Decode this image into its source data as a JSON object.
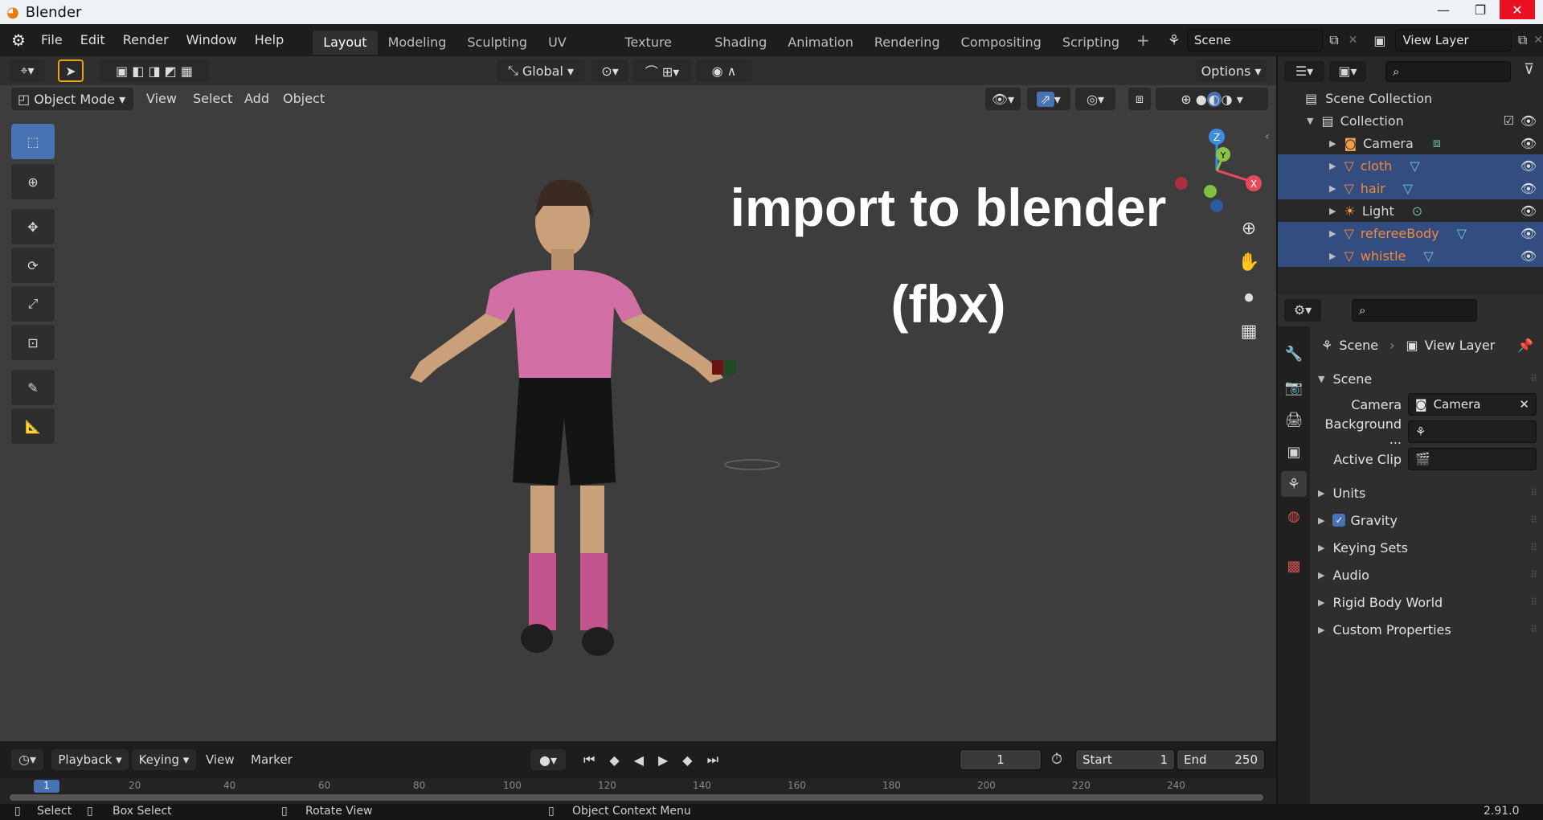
{
  "window": {
    "title": "Blender",
    "minimize": "—",
    "restore": "❐",
    "close": "✕"
  },
  "menu": [
    "File",
    "Edit",
    "Render",
    "Window",
    "Help"
  ],
  "workspaces": [
    "Layout",
    "Modeling",
    "Sculpting",
    "UV Editing",
    "Texture Paint",
    "Shading",
    "Animation",
    "Rendering",
    "Compositing",
    "Scripting"
  ],
  "active_workspace": "Layout",
  "scene_field": "Scene",
  "view_layer_field": "View Layer",
  "toolbar": {
    "transform_orientation": "Global",
    "options": "Options"
  },
  "viewport_header": {
    "mode": "Object Mode",
    "menus": [
      "View",
      "Select",
      "Add",
      "Object"
    ]
  },
  "overlay": {
    "line1": "import to blender",
    "line2": "(fbx)"
  },
  "gizmo": {
    "x": "X",
    "y": "Y",
    "z": "Z"
  },
  "outliner": {
    "root": "Scene Collection",
    "collection": "Collection",
    "items": [
      {
        "name": "Camera",
        "selected": false,
        "color": "#e0e0e0"
      },
      {
        "name": "cloth",
        "selected": true,
        "color": "#f08a3a"
      },
      {
        "name": "hair",
        "selected": true,
        "color": "#f08a3a"
      },
      {
        "name": "Light",
        "selected": false,
        "color": "#e0e0e0"
      },
      {
        "name": "refereeBody",
        "selected": true,
        "color": "#f08a3a"
      },
      {
        "name": "whistle",
        "selected": true,
        "color": "#f08a3a"
      }
    ]
  },
  "properties": {
    "breadcrumb_scene": "Scene",
    "breadcrumb_view_layer": "View Layer",
    "panel_title": "Scene",
    "camera_label": "Camera",
    "camera_value": "Camera",
    "background_label": "Background ...",
    "active_clip_label": "Active Clip",
    "sections": [
      "Units",
      "Gravity",
      "Keying Sets",
      "Audio",
      "Rigid Body World",
      "Custom Properties"
    ],
    "gravity_checked": true
  },
  "timeline": {
    "menus": [
      "Playback",
      "Keying",
      "View",
      "Marker"
    ],
    "current_frame": "1",
    "start_label": "Start",
    "start": "1",
    "end_label": "End",
    "end": "250",
    "ruler": [
      "1",
      "20",
      "40",
      "60",
      "80",
      "100",
      "120",
      "140",
      "160",
      "180",
      "200",
      "220",
      "240"
    ]
  },
  "status_bar": {
    "select": "Select",
    "box_select": "Box Select",
    "rotate": "Rotate View",
    "context": "Object Context Menu",
    "version": "2.91.0"
  },
  "colors": {
    "accent": "#4772b3",
    "selected_row": "#334d80",
    "object_orange": "#f08a3a"
  }
}
